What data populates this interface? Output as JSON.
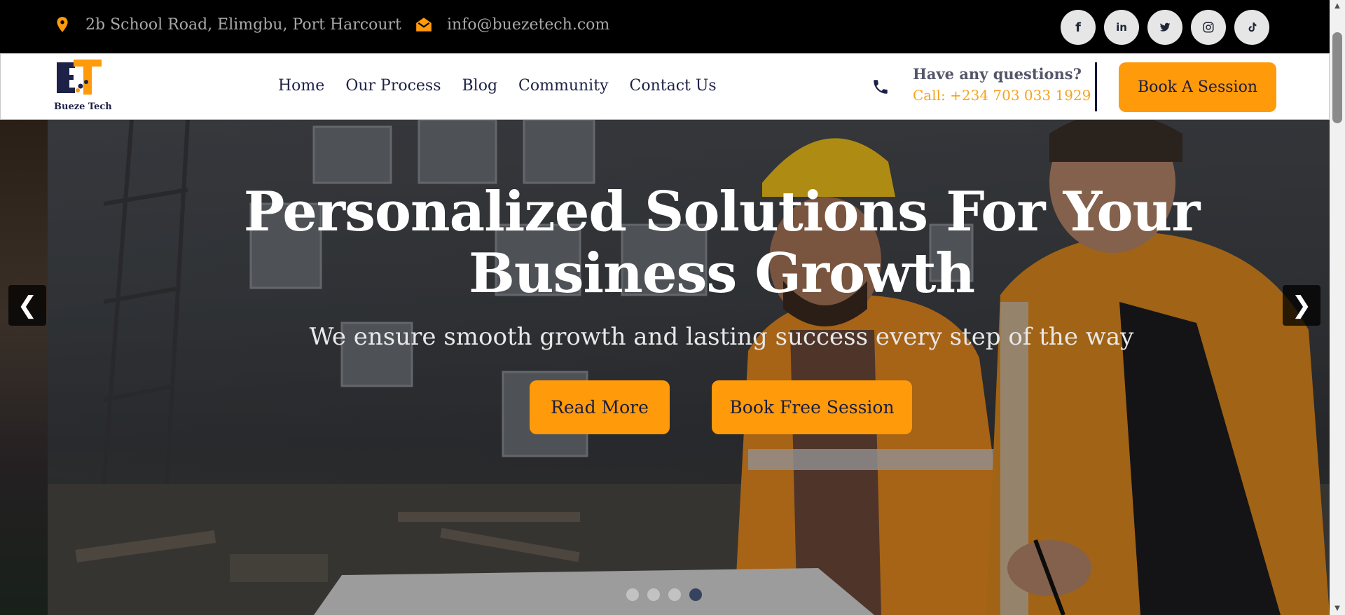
{
  "topbar": {
    "address": "2b School Road, Elimgbu, Port Harcourt",
    "email": "info@buezetech.com",
    "socials": [
      {
        "icon": "facebook-icon",
        "glyph": "f"
      },
      {
        "icon": "linkedin-icon",
        "glyph": "in"
      },
      {
        "icon": "twitter-icon",
        "glyph": "t"
      },
      {
        "icon": "instagram-icon",
        "glyph": "◎"
      },
      {
        "icon": "tiktok-icon",
        "glyph": "♪"
      }
    ]
  },
  "header": {
    "logo_text": "Bueze Tech",
    "nav": [
      "Home",
      "Our Process",
      "Blog",
      "Community",
      "Contact Us"
    ],
    "question_title": "Have any questions?",
    "question_phone": "Call: +234 703 033 1929",
    "book_label": "Book A Session"
  },
  "hero": {
    "title": "Personalized Solutions For Your Business Growth",
    "subtitle": "We ensure smooth growth and lasting success every step of the way",
    "read_more": "Read More",
    "book_free": "Book Free Session",
    "prev": "❮",
    "next": "❯",
    "slides": 4,
    "active_slide": 4
  },
  "colors": {
    "accent": "#ff9a0a",
    "navy": "#1d2147",
    "topbar_bg": "#000000"
  }
}
